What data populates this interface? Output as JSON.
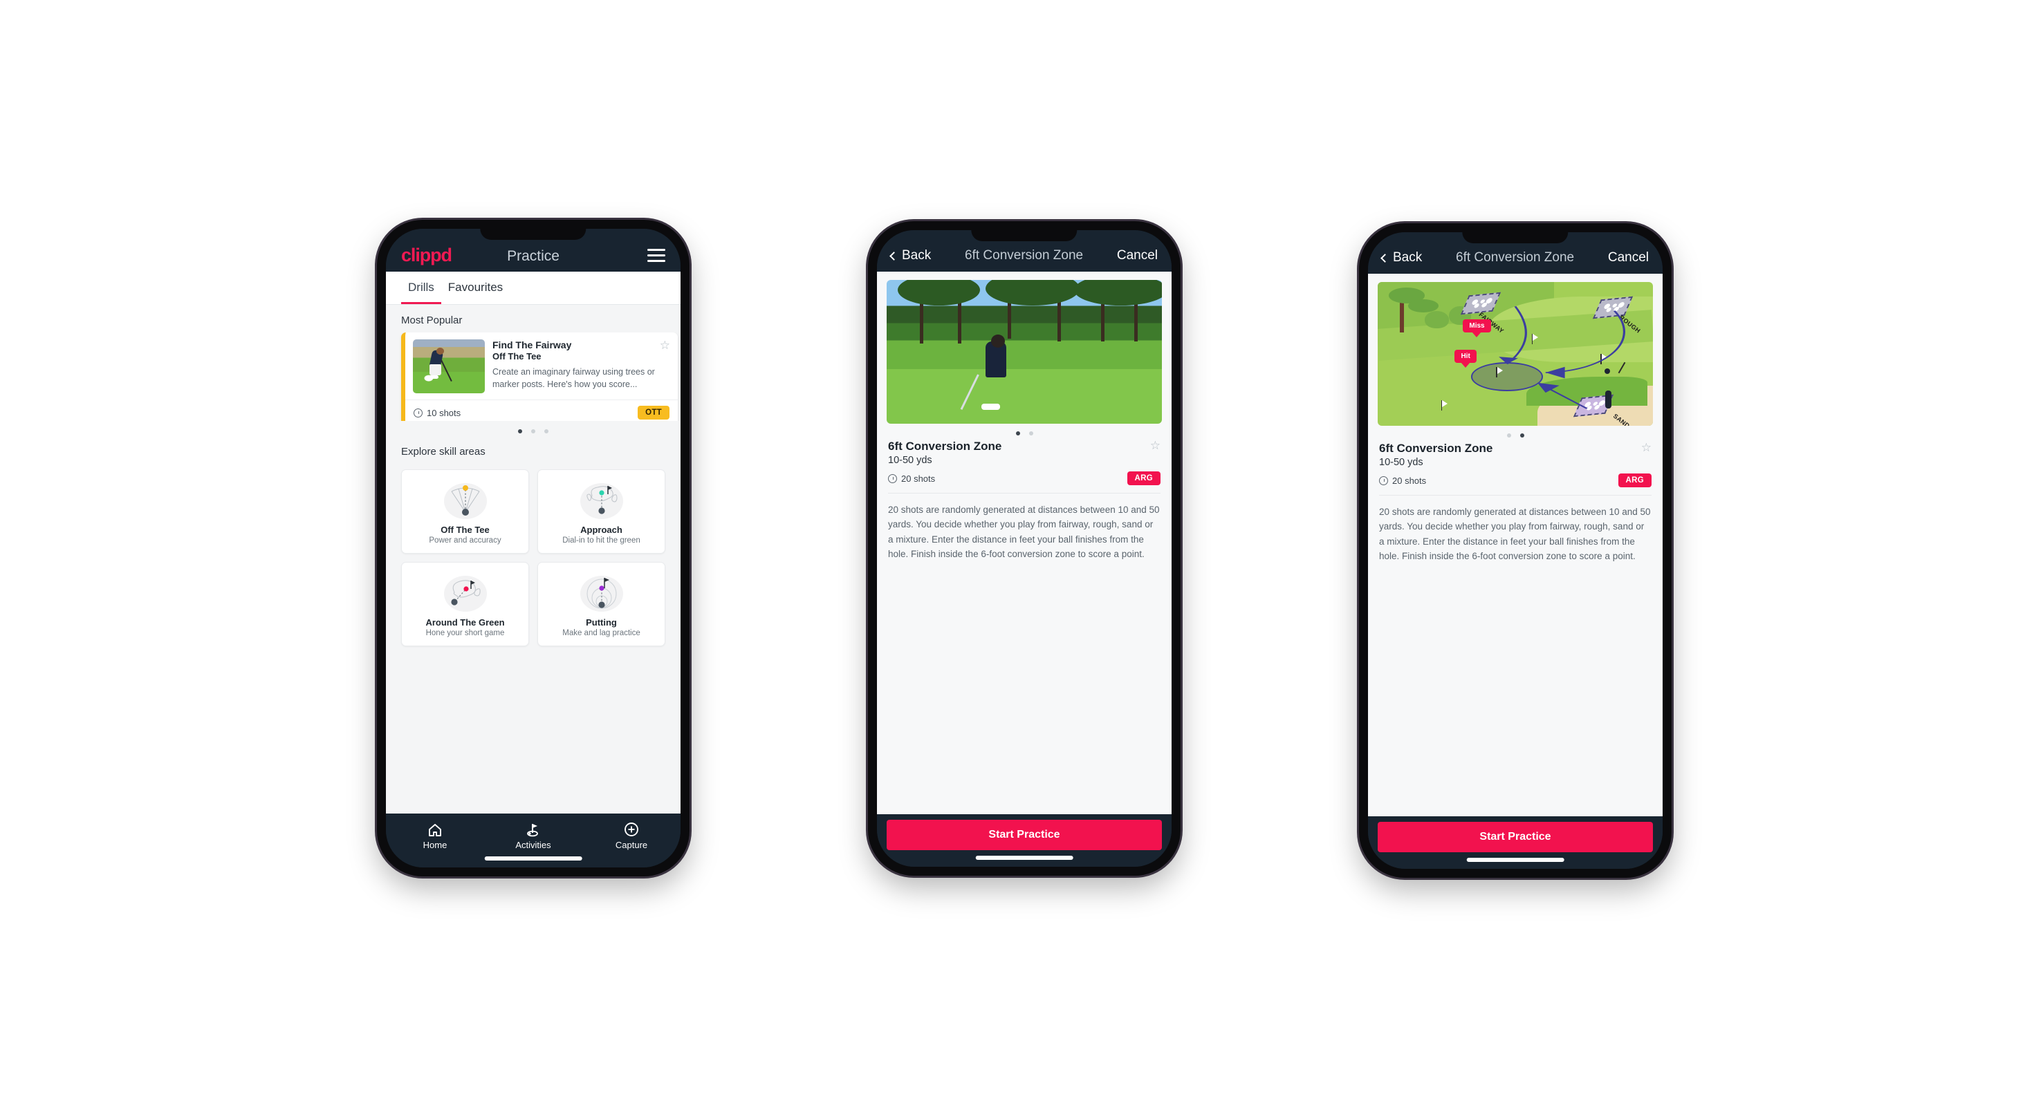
{
  "phone1": {
    "appbar": {
      "brand": "clippd",
      "title": "Practice",
      "menu_icon": "hamburger-menu-icon"
    },
    "tabs": [
      {
        "label": "Drills",
        "active": true
      },
      {
        "label": "Favourites",
        "active": false
      }
    ],
    "sections": {
      "most_popular": "Most Popular",
      "explore": "Explore skill areas"
    },
    "drill_card": {
      "title": "Find The Fairway",
      "subtitle": "Off The Tee",
      "description": "Create an imaginary fairway using trees or marker posts. Here's how you score...",
      "shots": "10 shots",
      "badge": "OTT",
      "accent_color": "#f6b81b",
      "badge_color": "#f8bc20",
      "star_icon": "star-outline-icon"
    },
    "carousel_dots": {
      "count": 3,
      "active": 0
    },
    "skill_areas": [
      {
        "name": "Off The Tee",
        "desc": "Power and accuracy",
        "icon": "tee-fan-icon",
        "dot_color": "#f5b81d"
      },
      {
        "name": "Approach",
        "desc": "Dial-in to hit the green",
        "icon": "approach-green-icon",
        "dot_color": "#2bd4ae"
      },
      {
        "name": "Around The Green",
        "desc": "Hone your short game",
        "icon": "around-green-icon",
        "dot_color": "#f2124e"
      },
      {
        "name": "Putting",
        "desc": "Make and lag practice",
        "icon": "putting-rings-icon",
        "dot_color": "#9b2bd4"
      }
    ],
    "tabbar": [
      {
        "label": "Home",
        "icon": "home-icon",
        "active": false
      },
      {
        "label": "Activities",
        "icon": "golf-flag-icon",
        "active": true
      },
      {
        "label": "Capture",
        "icon": "plus-circle-icon",
        "active": false
      }
    ]
  },
  "phone2": {
    "navbar": {
      "back": "Back",
      "title": "6ft Conversion Zone",
      "cancel": "Cancel",
      "back_icon": "chevron-left-icon"
    },
    "media_type": "video-photo",
    "dots": {
      "count": 2,
      "active": 0
    },
    "detail": {
      "title": "6ft Conversion Zone",
      "distance": "10-50 yds",
      "shots": "20 shots",
      "badge": "ARG",
      "badge_color": "#f2124e",
      "star_icon": "star-outline-icon",
      "description": "20 shots are randomly generated at distances between 10 and 50 yards. You decide whether you play from fairway, rough, sand or a mixture. Enter the distance in feet your ball finishes from the hole. Finish inside the 6-foot conversion zone to score a point."
    },
    "cta": "Start Practice"
  },
  "phone3": {
    "navbar": {
      "back": "Back",
      "title": "6ft Conversion Zone",
      "cancel": "Cancel",
      "back_icon": "chevron-left-icon"
    },
    "media_type": "illustration",
    "illustration": {
      "labels": [
        "FAIRWAY",
        "ROUGH",
        "SAND"
      ],
      "callouts": [
        "Miss",
        "Hit"
      ],
      "callout_color": "#f2124e"
    },
    "dots": {
      "count": 2,
      "active": 1
    },
    "detail": {
      "title": "6ft Conversion Zone",
      "distance": "10-50 yds",
      "shots": "20 shots",
      "badge": "ARG",
      "badge_color": "#f2124e",
      "star_icon": "star-outline-icon",
      "description": "20 shots are randomly generated at distances between 10 and 50 yards. You decide whether you play from fairway, rough, sand or a mixture. Enter the distance in feet your ball finishes from the hole. Finish inside the 6-foot conversion zone to score a point."
    },
    "cta": "Start Practice"
  }
}
